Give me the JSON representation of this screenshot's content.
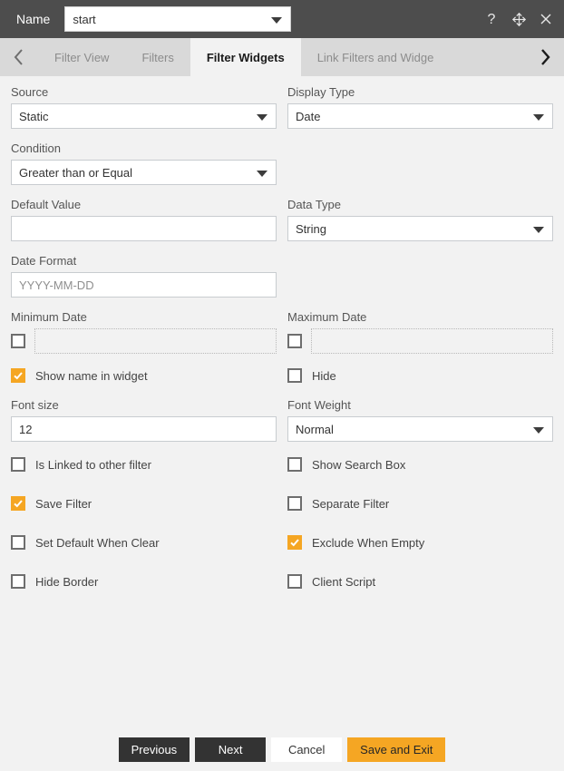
{
  "titlebar": {
    "name_label": "Name",
    "name_value": "start",
    "icons": [
      {
        "name": "help-icon",
        "glyph": "?"
      },
      {
        "name": "move-icon",
        "glyph": "move"
      },
      {
        "name": "close-icon",
        "glyph": "x"
      }
    ]
  },
  "tabs": {
    "prev_arrow": "chevron-left-icon",
    "next_arrow": "chevron-right-icon",
    "items": [
      {
        "label": "Filter View",
        "active": false
      },
      {
        "label": "Filters",
        "active": false
      },
      {
        "label": "Filter Widgets",
        "active": true
      },
      {
        "label": "Link Filters and Widge",
        "active": false
      }
    ]
  },
  "form": {
    "source": {
      "label": "Source",
      "value": "Static"
    },
    "display_type": {
      "label": "Display Type",
      "value": "Date"
    },
    "condition": {
      "label": "Condition",
      "value": "Greater than or Equal"
    },
    "default_value": {
      "label": "Default Value",
      "value": ""
    },
    "data_type": {
      "label": "Data Type",
      "value": "String"
    },
    "date_format": {
      "label": "Date Format",
      "placeholder": "YYYY-MM-DD",
      "value": ""
    },
    "minimum_date": {
      "label": "Minimum Date",
      "checked": false,
      "value": ""
    },
    "maximum_date": {
      "label": "Maximum Date",
      "checked": false,
      "value": ""
    },
    "show_name_in_widget": {
      "label": "Show name in widget",
      "checked": true
    },
    "hide": {
      "label": "Hide",
      "checked": false
    },
    "font_size": {
      "label": "Font size",
      "value": "12"
    },
    "font_weight": {
      "label": "Font Weight",
      "value": "Normal"
    },
    "options": [
      [
        {
          "label": "Is Linked to other filter",
          "checked": false
        },
        {
          "label": "Show Search Box",
          "checked": false
        }
      ],
      [
        {
          "label": "Save Filter",
          "checked": true
        },
        {
          "label": "Separate Filter",
          "checked": false
        }
      ],
      [
        {
          "label": "Set Default When Clear",
          "checked": false
        },
        {
          "label": "Exclude When Empty",
          "checked": true
        }
      ],
      [
        {
          "label": "Hide Border",
          "checked": false
        },
        {
          "label": "Client Script",
          "checked": false
        }
      ]
    ]
  },
  "footer": {
    "previous": "Previous",
    "next": "Next",
    "cancel": "Cancel",
    "save_and_exit": "Save and Exit"
  },
  "colors": {
    "accent": "#f5a623",
    "titlebar": "#4d4d4d",
    "tabstrip": "#d9d9d9",
    "body": "#f2f2f2",
    "dark_button": "#333333"
  }
}
